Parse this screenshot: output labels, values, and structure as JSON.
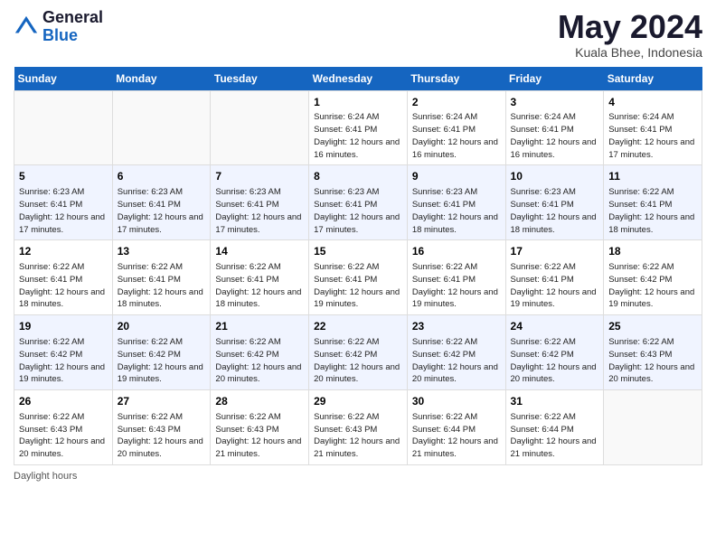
{
  "logo": {
    "general": "General",
    "blue": "Blue"
  },
  "title": "May 2024",
  "location": "Kuala Bhee, Indonesia",
  "days_of_week": [
    "Sunday",
    "Monday",
    "Tuesday",
    "Wednesday",
    "Thursday",
    "Friday",
    "Saturday"
  ],
  "footer": "Daylight hours",
  "weeks": [
    [
      {
        "day": "",
        "info": ""
      },
      {
        "day": "",
        "info": ""
      },
      {
        "day": "",
        "info": ""
      },
      {
        "day": "1",
        "info": "Sunrise: 6:24 AM\nSunset: 6:41 PM\nDaylight: 12 hours\nand 16 minutes."
      },
      {
        "day": "2",
        "info": "Sunrise: 6:24 AM\nSunset: 6:41 PM\nDaylight: 12 hours\nand 16 minutes."
      },
      {
        "day": "3",
        "info": "Sunrise: 6:24 AM\nSunset: 6:41 PM\nDaylight: 12 hours\nand 16 minutes."
      },
      {
        "day": "4",
        "info": "Sunrise: 6:24 AM\nSunset: 6:41 PM\nDaylight: 12 hours\nand 17 minutes."
      }
    ],
    [
      {
        "day": "5",
        "info": "Sunrise: 6:23 AM\nSunset: 6:41 PM\nDaylight: 12 hours\nand 17 minutes."
      },
      {
        "day": "6",
        "info": "Sunrise: 6:23 AM\nSunset: 6:41 PM\nDaylight: 12 hours\nand 17 minutes."
      },
      {
        "day": "7",
        "info": "Sunrise: 6:23 AM\nSunset: 6:41 PM\nDaylight: 12 hours\nand 17 minutes."
      },
      {
        "day": "8",
        "info": "Sunrise: 6:23 AM\nSunset: 6:41 PM\nDaylight: 12 hours\nand 17 minutes."
      },
      {
        "day": "9",
        "info": "Sunrise: 6:23 AM\nSunset: 6:41 PM\nDaylight: 12 hours\nand 18 minutes."
      },
      {
        "day": "10",
        "info": "Sunrise: 6:23 AM\nSunset: 6:41 PM\nDaylight: 12 hours\nand 18 minutes."
      },
      {
        "day": "11",
        "info": "Sunrise: 6:22 AM\nSunset: 6:41 PM\nDaylight: 12 hours\nand 18 minutes."
      }
    ],
    [
      {
        "day": "12",
        "info": "Sunrise: 6:22 AM\nSunset: 6:41 PM\nDaylight: 12 hours\nand 18 minutes."
      },
      {
        "day": "13",
        "info": "Sunrise: 6:22 AM\nSunset: 6:41 PM\nDaylight: 12 hours\nand 18 minutes."
      },
      {
        "day": "14",
        "info": "Sunrise: 6:22 AM\nSunset: 6:41 PM\nDaylight: 12 hours\nand 18 minutes."
      },
      {
        "day": "15",
        "info": "Sunrise: 6:22 AM\nSunset: 6:41 PM\nDaylight: 12 hours\nand 19 minutes."
      },
      {
        "day": "16",
        "info": "Sunrise: 6:22 AM\nSunset: 6:41 PM\nDaylight: 12 hours\nand 19 minutes."
      },
      {
        "day": "17",
        "info": "Sunrise: 6:22 AM\nSunset: 6:41 PM\nDaylight: 12 hours\nand 19 minutes."
      },
      {
        "day": "18",
        "info": "Sunrise: 6:22 AM\nSunset: 6:42 PM\nDaylight: 12 hours\nand 19 minutes."
      }
    ],
    [
      {
        "day": "19",
        "info": "Sunrise: 6:22 AM\nSunset: 6:42 PM\nDaylight: 12 hours\nand 19 minutes."
      },
      {
        "day": "20",
        "info": "Sunrise: 6:22 AM\nSunset: 6:42 PM\nDaylight: 12 hours\nand 19 minutes."
      },
      {
        "day": "21",
        "info": "Sunrise: 6:22 AM\nSunset: 6:42 PM\nDaylight: 12 hours\nand 20 minutes."
      },
      {
        "day": "22",
        "info": "Sunrise: 6:22 AM\nSunset: 6:42 PM\nDaylight: 12 hours\nand 20 minutes."
      },
      {
        "day": "23",
        "info": "Sunrise: 6:22 AM\nSunset: 6:42 PM\nDaylight: 12 hours\nand 20 minutes."
      },
      {
        "day": "24",
        "info": "Sunrise: 6:22 AM\nSunset: 6:42 PM\nDaylight: 12 hours\nand 20 minutes."
      },
      {
        "day": "25",
        "info": "Sunrise: 6:22 AM\nSunset: 6:43 PM\nDaylight: 12 hours\nand 20 minutes."
      }
    ],
    [
      {
        "day": "26",
        "info": "Sunrise: 6:22 AM\nSunset: 6:43 PM\nDaylight: 12 hours\nand 20 minutes."
      },
      {
        "day": "27",
        "info": "Sunrise: 6:22 AM\nSunset: 6:43 PM\nDaylight: 12 hours\nand 20 minutes."
      },
      {
        "day": "28",
        "info": "Sunrise: 6:22 AM\nSunset: 6:43 PM\nDaylight: 12 hours\nand 21 minutes."
      },
      {
        "day": "29",
        "info": "Sunrise: 6:22 AM\nSunset: 6:43 PM\nDaylight: 12 hours\nand 21 minutes."
      },
      {
        "day": "30",
        "info": "Sunrise: 6:22 AM\nSunset: 6:44 PM\nDaylight: 12 hours\nand 21 minutes."
      },
      {
        "day": "31",
        "info": "Sunrise: 6:22 AM\nSunset: 6:44 PM\nDaylight: 12 hours\nand 21 minutes."
      },
      {
        "day": "",
        "info": ""
      }
    ]
  ]
}
